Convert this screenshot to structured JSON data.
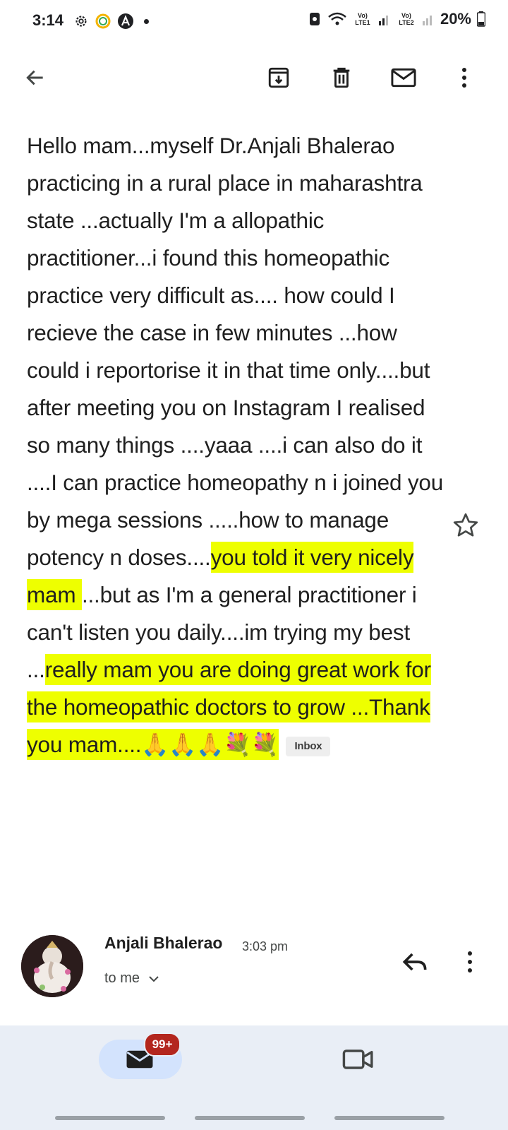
{
  "status_bar": {
    "time": "3:14",
    "sim1_label": "Vo) LTE1",
    "sim2_label": "Vo) LTE2",
    "battery": "20%"
  },
  "toolbar": {
    "icons": [
      "back-arrow-icon",
      "archive-icon",
      "delete-icon",
      "mark-unread-icon",
      "more-vert-icon"
    ]
  },
  "message": {
    "segments": [
      {
        "text": "Hello mam...myself Dr.Anjali Bhalerao practicing in a rural place in maharashtra state ...actually I'm a allopathic practitioner...i found this homeopathic practice very difficult as.... how could I recieve the case in few minutes ...how could i reportorise it in that time only....but after meeting you on Instagram I realised so many things ....yaaa ....i can also do it ....I can practice homeopathy n i joined you by mega sessions .....how to manage potency n doses....",
        "highlight": false
      },
      {
        "text": "you told it very nicely mam ",
        "highlight": true
      },
      {
        "text": "...but as I'm a general practitioner i can't listen you daily....im trying my best ...",
        "highlight": false
      },
      {
        "text": "really mam you are doing great work for the homeopathic doctors to grow ...Thank you mam....🙏🙏🙏💐💐",
        "highlight": true
      }
    ],
    "label_chip": "Inbox"
  },
  "sender": {
    "name": "Anjali Bhalerao",
    "time": "3:03 pm",
    "recipient": "to me"
  },
  "bottom_nav": {
    "mail_badge": "99+"
  },
  "colors": {
    "highlight": "#eeff00",
    "badge": "#b3261e",
    "nav_bg": "#e9eef6",
    "mail_pill": "#d3e3fd"
  }
}
